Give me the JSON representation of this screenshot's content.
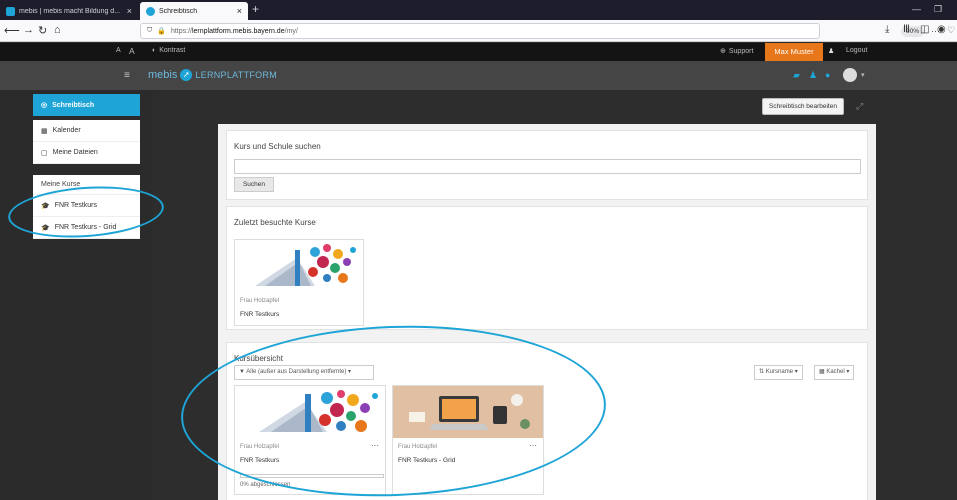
{
  "browser": {
    "tabs": [
      {
        "label": "mebis | mebis macht Bildung d...",
        "favicon_color": "#1ea4d6"
      },
      {
        "label": "Schreibtisch",
        "favicon_color": "#1ea4d6"
      }
    ],
    "url_prefix": "https://",
    "url_host": "lernplattform.mebis.bayern.de",
    "url_path": "/my/",
    "zoom": "90%"
  },
  "topbar": {
    "font_decrease": "A",
    "font_increase": "A",
    "contrast": "Kontrast",
    "support": "Support",
    "user": "Max Muster",
    "logout": "Logout"
  },
  "header": {
    "logo_text": "mebis",
    "logo_sub": "LERNPLATTFORM"
  },
  "sidebar": {
    "active": "Schreibtisch",
    "items": [
      "Kalender",
      "Meine Dateien"
    ],
    "courses_heading": "Meine Kurse",
    "courses": [
      "FNR Testkurs",
      "FNR Testkurs - Grid"
    ]
  },
  "main": {
    "edit_button": "Schreibtisch bearbeiten",
    "search": {
      "title": "Kurs und Schule suchen",
      "button": "Suchen",
      "value": ""
    },
    "recent": {
      "title": "Zuletzt besuchte Kurse",
      "courses": [
        {
          "teacher": "Frau Holzapfel",
          "name": "FNR Testkurs"
        }
      ]
    },
    "overview": {
      "title": "Kursübersicht",
      "filter": "Alle (außer aus Darstellung entfernte)",
      "sort": "Kursname",
      "view": "Kachel",
      "courses": [
        {
          "teacher": "Frau Holzapfel",
          "name": "FNR Testkurs",
          "progress_label": "0% abgeschlossen",
          "progress": 0
        },
        {
          "teacher": "Frau Holzapfel",
          "name": "FNR Testkurs - Grid"
        }
      ]
    }
  },
  "colors": {
    "accent": "#1ea4d6",
    "user_badge": "#e8761a",
    "annotation": "#1ea4d6"
  }
}
